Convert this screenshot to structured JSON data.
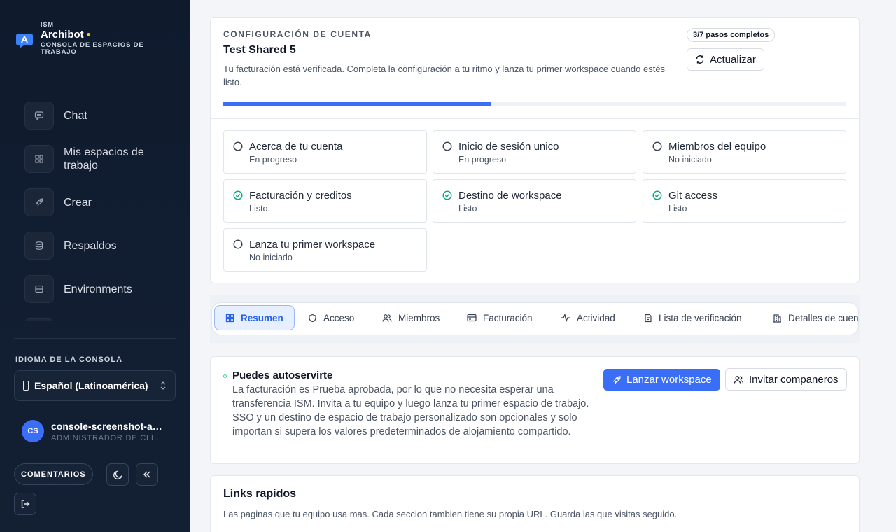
{
  "brand": {
    "small": "ISM",
    "name": "Archibot",
    "subtitle": "CONSOLA DE ESPACIOS DE TRABAJO"
  },
  "nav": [
    {
      "label": "Chat",
      "icon": "chat-icon"
    },
    {
      "label": "Mis espacios de trabajo",
      "icon": "grid-icon"
    },
    {
      "label": "Crear",
      "icon": "rocket-icon"
    },
    {
      "label": "Respaldos",
      "icon": "database-icon"
    },
    {
      "label": "Environments",
      "icon": "server-icon"
    }
  ],
  "language": {
    "title": "IDIOMA DE LA CONSOLA",
    "value": "Español (Latinoamérica)"
  },
  "user": {
    "initials": "CS",
    "name": "console-screenshot-admin",
    "role": "ADMINISTRADOR DE CLIENTE"
  },
  "footer": {
    "feedback": "COMENTARIOS"
  },
  "setup": {
    "eyebrow": "CONFIGURACIÓN DE CUENTA",
    "title": "Test Shared 5",
    "description": "Tu facturación está verificada. Completa la configuración a tu ritmo y lanza tu primer workspace cuando estés listo.",
    "badge": "3/7 pasos completos",
    "refresh": "Actualizar",
    "progress_fraction": 0.43,
    "steps": [
      {
        "title": "Acerca de tu cuenta",
        "status": "En progreso",
        "done": false
      },
      {
        "title": "Inicio de sesión unico",
        "status": "En progreso",
        "done": false
      },
      {
        "title": "Miembros del equipo",
        "status": "No iniciado",
        "done": false
      },
      {
        "title": "Facturación y creditos",
        "status": "Listo",
        "done": true
      },
      {
        "title": "Destino de workspace",
        "status": "Listo",
        "done": true
      },
      {
        "title": "Git access",
        "status": "Listo",
        "done": true
      },
      {
        "title": "Lanza tu primer workspace",
        "status": "No iniciado",
        "done": false
      }
    ]
  },
  "tabs": [
    {
      "label": "Resumen",
      "icon": "grid-icon",
      "active": true
    },
    {
      "label": "Acceso",
      "icon": "shield-icon",
      "active": false
    },
    {
      "label": "Miembros",
      "icon": "users-icon",
      "active": false
    },
    {
      "label": "Facturación",
      "icon": "card-icon",
      "active": false
    },
    {
      "label": "Actividad",
      "icon": "activity-icon",
      "active": false
    },
    {
      "label": "Lista de verificación",
      "icon": "checklist-icon",
      "active": false
    },
    {
      "label": "Detalles de cuenta",
      "icon": "building-icon",
      "active": false
    }
  ],
  "selfserve": {
    "title": "Puedes autoservirte",
    "description": "La facturación es Prueba aprobada, por lo que no necesita esperar una transferencia ISM. Invita a tu equipo y luego lanza tu primer espacio de trabajo. SSO y un destino de espacio de trabajo personalizado son opcionales y solo importan si supera los valores predeterminados de alojamiento compartido.",
    "launch": "Lanzar workspace",
    "invite": "Invitar companeros"
  },
  "quicklinks": {
    "title": "Links rapidos",
    "description": "Las paginas que tu equipo usa mas. Cada seccion tambien tiene su propia URL. Guarda las que visitas seguido."
  }
}
